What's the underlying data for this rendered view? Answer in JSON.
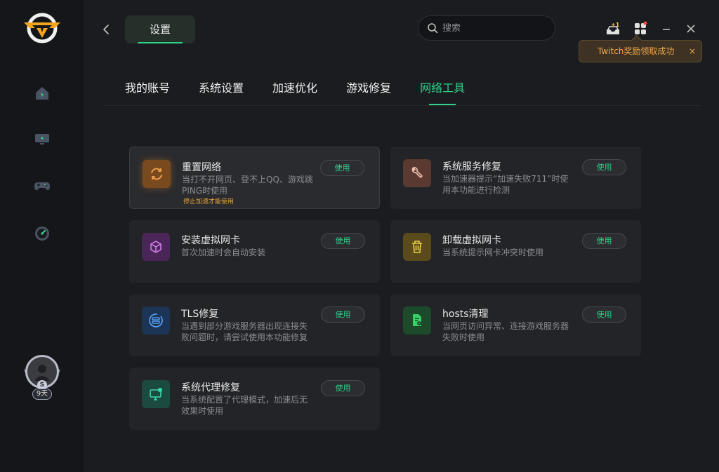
{
  "header": {
    "title": "设置",
    "search_placeholder": "搜索",
    "notification_badge": "+1"
  },
  "toast": {
    "message": "Twitch奖励领取成功",
    "close": "×"
  },
  "user": {
    "days": "9天",
    "coin": "S"
  },
  "tabs": [
    {
      "label": "我的账号"
    },
    {
      "label": "系统设置"
    },
    {
      "label": "加速优化"
    },
    {
      "label": "游戏修复"
    },
    {
      "label": "网络工具"
    }
  ],
  "active_tab": "网络工具",
  "tools": [
    {
      "title": "重置网络",
      "desc": "当打不开网页、登不上QQ、游戏跳PING时使用",
      "note": "停止加速才能使用",
      "button": "使用",
      "icon": "refresh-icon",
      "color": "#e8892e"
    },
    {
      "title": "系统服务修复",
      "desc": "当加速器提示“加速失败711”时使用本功能进行检测",
      "button": "使用",
      "icon": "wrench-icon",
      "color": "#e07a5a"
    },
    {
      "title": "安装虚拟网卡",
      "desc": "首次加速时会自动安装",
      "button": "使用",
      "icon": "cube-icon",
      "color": "#b65bd8"
    },
    {
      "title": "卸载虚拟网卡",
      "desc": "当系统提示网卡冲突时使用",
      "button": "使用",
      "icon": "trash-icon",
      "color": "#e8c52e"
    },
    {
      "title": "TLS修复",
      "desc": "当遇到部分游戏服务器出现连接失败问题时，请尝试使用本功能修复",
      "button": "使用",
      "icon": "server-refresh-icon",
      "color": "#3d8fe8"
    },
    {
      "title": "hosts清理",
      "desc": "当网页访问异常、连接游戏服务器失败时使用",
      "button": "使用",
      "icon": "doc-clean-icon",
      "color": "#2fd05a"
    },
    {
      "title": "系统代理修复",
      "desc": "当系统配置了代理模式，加速后无效果时使用",
      "button": "使用",
      "icon": "monitor-proxy-icon",
      "color": "#2fd0a0"
    }
  ]
}
